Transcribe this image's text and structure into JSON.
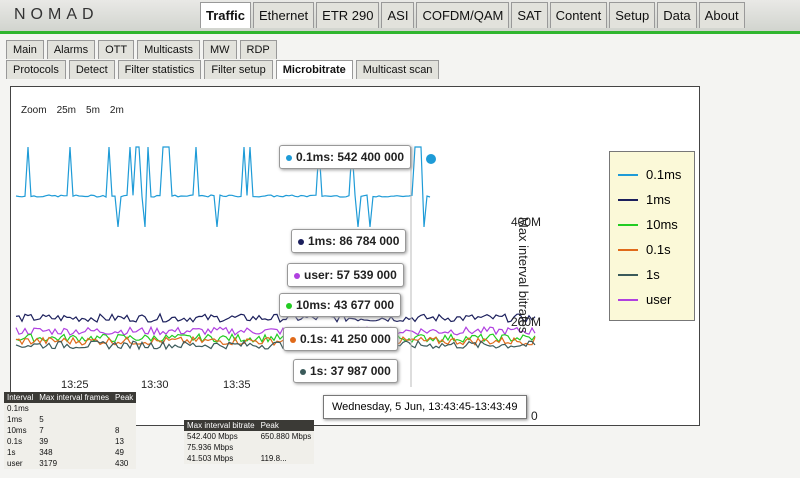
{
  "brand": "NOMAD",
  "top_tabs": [
    "Traffic",
    "Ethernet",
    "ETR 290",
    "ASI",
    "COFDM/QAM",
    "SAT",
    "Content",
    "Setup",
    "Data",
    "About"
  ],
  "sub_tabs": [
    "Main",
    "Alarms",
    "OTT",
    "Multicasts",
    "MW",
    "RDP"
  ],
  "traffic_tabs": [
    "Protocols",
    "Detect",
    "Filter statistics",
    "Filter setup",
    "Microbitrate",
    "Multicast scan"
  ],
  "active": {
    "top": "Traffic",
    "traffic": "Microbitrate"
  },
  "zoom": {
    "label": "Zoom",
    "options": [
      "25m",
      "5m",
      "2m"
    ]
  },
  "chart": {
    "y_title": "Max interval bitrates",
    "y_ticks": [
      "400M",
      "200M",
      "0"
    ],
    "x_ticks": [
      "13:25",
      "13:30",
      "13:35"
    ],
    "legend": [
      {
        "name": "0.1ms",
        "color": "#1e9bd7"
      },
      {
        "name": "1ms",
        "color": "#1b1f5c"
      },
      {
        "name": "10ms",
        "color": "#22cc22"
      },
      {
        "name": "0.1s",
        "color": "#e06a1a"
      },
      {
        "name": "1s",
        "color": "#3a5a5a"
      },
      {
        "name": "user",
        "color": "#b040e0"
      }
    ],
    "tooltips": [
      {
        "label": "0.1ms: 542 400 000",
        "color": "#1e9bd7"
      },
      {
        "label": "1ms: 86 784 000",
        "color": "#1b1f5c"
      },
      {
        "label": "user: 57 539 000",
        "color": "#b040e0"
      },
      {
        "label": "10ms: 43 677 000",
        "color": "#22cc22"
      },
      {
        "label": "0.1s: 41 250 000",
        "color": "#e06a1a"
      },
      {
        "label": "1s: 37 987 000",
        "color": "#3a5a5a"
      }
    ],
    "date_tooltip": "Wednesday, 5 Jun, 13:43:45-13:43:49"
  },
  "table1": {
    "headers": [
      "Interval",
      "Max interval frames",
      "Peak"
    ],
    "rows": [
      [
        "0.1ms",
        "",
        ""
      ],
      [
        "1ms",
        "5",
        ""
      ],
      [
        "10ms",
        "7",
        "8"
      ],
      [
        "0.1s",
        "39",
        "13"
      ],
      [
        "1s",
        "348",
        "49"
      ],
      [
        "user",
        "3179",
        "430"
      ]
    ]
  },
  "table2": {
    "headers": [
      "Max interval bitrate",
      "Peak"
    ],
    "rows": [
      [
        "542.400 Mbps",
        "650.880 Mbps"
      ],
      [
        "75.936 Mbps",
        ""
      ],
      [
        "41.503 Mbps",
        "119.8..."
      ]
    ]
  }
}
